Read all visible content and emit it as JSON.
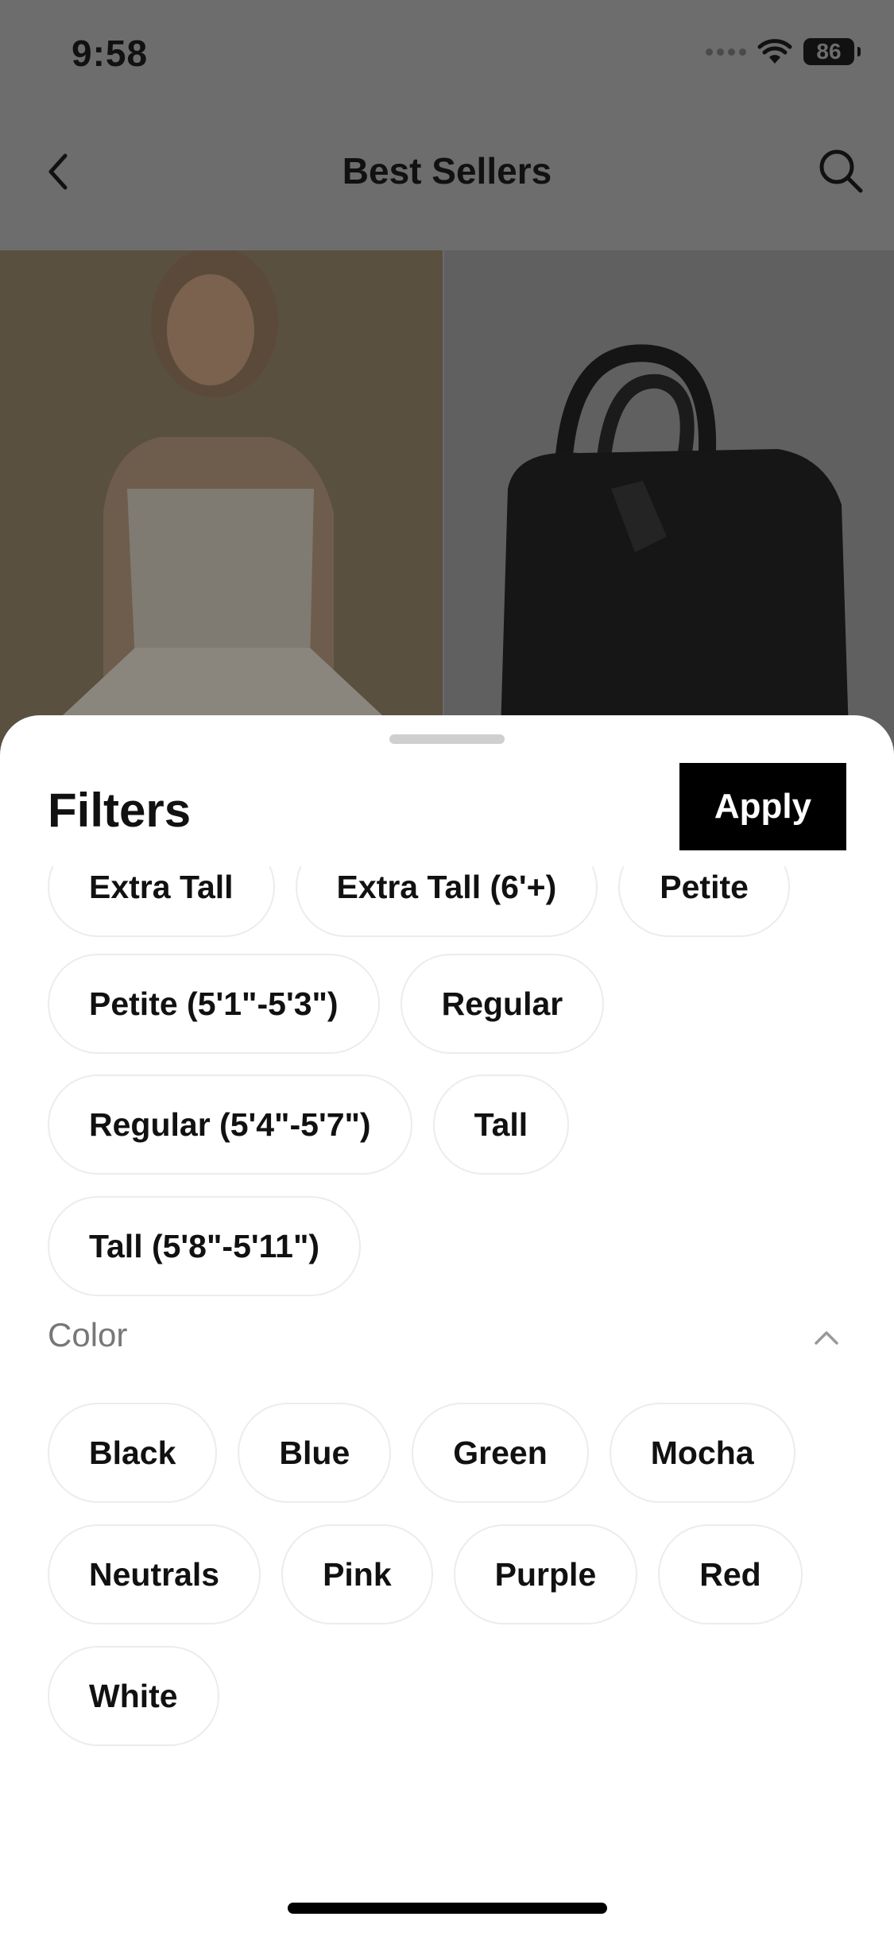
{
  "status": {
    "time": "9:58",
    "battery": "86"
  },
  "nav": {
    "title": "Best Sellers"
  },
  "sheet": {
    "title": "Filters",
    "apply_label": "Apply"
  },
  "height_chips": [
    [
      "Extra Tall",
      "Extra Tall (6'+)",
      "Petite"
    ],
    [
      "Petite (5'1\"-5'3\")",
      "Regular"
    ],
    [
      "Regular (5'4\"-5'7\")",
      "Tall"
    ],
    [
      "Tall (5'8\"-5'11\")"
    ]
  ],
  "color_section": {
    "title": "Color",
    "chips": [
      [
        "Black",
        "Blue",
        "Green",
        "Mocha"
      ],
      [
        "Neutrals",
        "Pink",
        "Purple",
        "Red"
      ],
      [
        "White"
      ]
    ]
  },
  "icons": {
    "back": "chevron-left-icon",
    "search": "search-icon",
    "collapse": "chevron-up-icon",
    "wifi": "wifi-icon",
    "battery": "battery-icon"
  }
}
